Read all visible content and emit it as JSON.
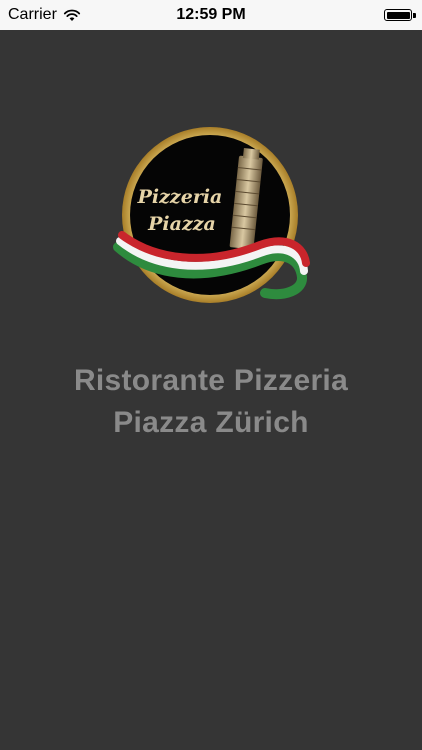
{
  "status_bar": {
    "carrier": "Carrier",
    "time": "12:59 PM"
  },
  "logo": {
    "line1": "Pizzeria",
    "line2": "Piazza"
  },
  "restaurant": {
    "name_line1": "Ristorante Pizzeria",
    "name_line2": "Piazza Zürich"
  },
  "colors": {
    "background": "#353535",
    "status_bar": "#f7f7f7",
    "title_text": "#8a8a8a",
    "logo_gold": "#d6b25c",
    "flag_green": "#2e8b3e",
    "flag_red": "#c9252c"
  }
}
